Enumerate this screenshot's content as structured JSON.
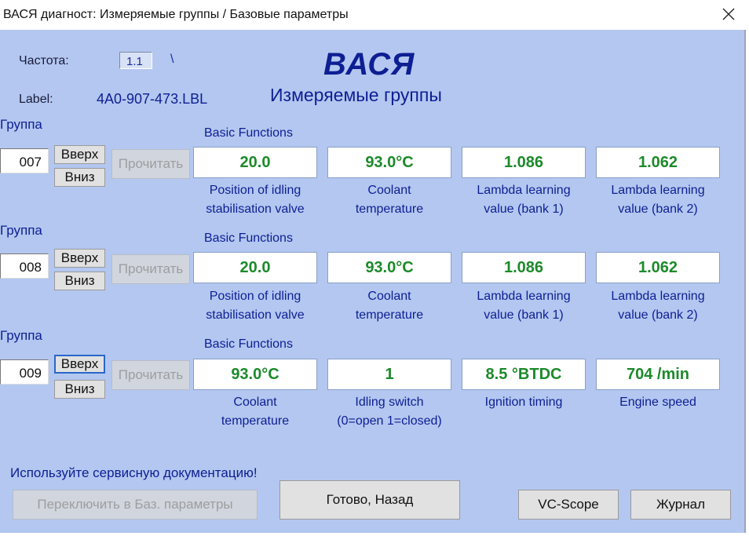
{
  "window": {
    "title": "ВАСЯ диагност: Измеряемые группы / Базовые параметры"
  },
  "header": {
    "freq_label": "Частота:",
    "freq_value": "1.1",
    "freq_slash": "\\",
    "label_label": "Label:",
    "label_value": "4A0-907-473.LBL",
    "logo": "ВАСЯ",
    "subtitle": "Измеряемые группы"
  },
  "groups": [
    {
      "title": "Группа",
      "number": "007",
      "up_label": "Вверх",
      "down_label": "Вниз",
      "read_label": "Прочитать",
      "mode": "Basic Functions",
      "values": [
        "20.0",
        "93.0°C",
        "1.086",
        "1.062"
      ],
      "descs": [
        [
          "Position of idling",
          "stabilisation valve"
        ],
        [
          "Coolant",
          "temperature"
        ],
        [
          "Lambda learning",
          "value (bank 1)"
        ],
        [
          "Lambda learning",
          "value (bank 2)"
        ]
      ]
    },
    {
      "title": "Группа",
      "number": "008",
      "up_label": "Вверх",
      "down_label": "Вниз",
      "read_label": "Прочитать",
      "mode": "Basic Functions",
      "values": [
        "20.0",
        "93.0°C",
        "1.086",
        "1.062"
      ],
      "descs": [
        [
          "Position of idling",
          "stabilisation valve"
        ],
        [
          "Coolant",
          "temperature"
        ],
        [
          "Lambda learning",
          "value (bank 1)"
        ],
        [
          "Lambda learning",
          "value (bank 2)"
        ]
      ]
    },
    {
      "title": "Группа",
      "number": "009",
      "up_label": "Вверх",
      "down_label": "Вниз",
      "read_label": "Прочитать",
      "mode": "Basic Functions",
      "values": [
        "93.0°C",
        "1",
        "8.5 °BTDC",
        "704 /min"
      ],
      "descs": [
        [
          "Coolant",
          "temperature"
        ],
        [
          "Idling switch",
          "(0=open 1=closed)"
        ],
        [
          "Ignition timing",
          ""
        ],
        [
          "Engine speed",
          ""
        ]
      ]
    }
  ],
  "footer": {
    "service_text": "Используйте сервисную документацию!",
    "switch_label": "Переключить в Баз. параметры",
    "done_label": "Готово, Назад",
    "vcscope_label": "VC-Scope",
    "journal_label": "Журнал"
  },
  "colors": {
    "client_bg": "#b3c7f0",
    "value_green": "#1c8a2a",
    "text_blue": "#0e1e93"
  }
}
